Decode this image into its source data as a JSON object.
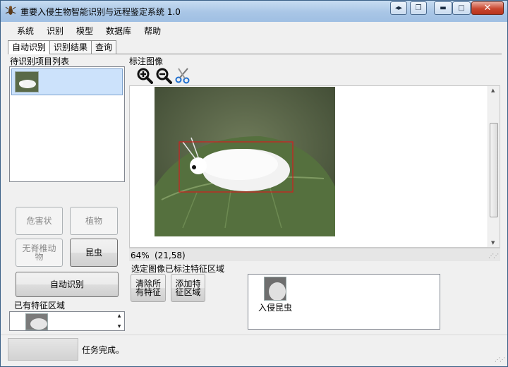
{
  "window": {
    "title": "重要入侵生物智能识别与远程鉴定系统 1.0",
    "accent": "#3a5f86"
  },
  "menu": [
    "系统",
    "识别",
    "模型",
    "数据库",
    "帮助"
  ],
  "tabs": [
    "自动识别",
    "识别结果",
    "查询"
  ],
  "left": {
    "pending_label": "待识别项目列表",
    "buttons": {
      "harm": "危害状",
      "plant": "植物",
      "invert_line1": "无脊椎动",
      "invert_line2": "物",
      "insect": "昆虫",
      "auto": "自动识别"
    },
    "feature_label": "已有特征区域"
  },
  "image_panel": {
    "label": "标注图像",
    "tools": [
      "zoom-in-icon",
      "zoom-out-icon",
      "scissors-icon"
    ],
    "zoom": "64%",
    "coords": "(21,58)",
    "selected_label": "选定图像已标注特征区域",
    "clear_line1": "清除所",
    "clear_line2": "有特征",
    "add_line1": "添加特",
    "add_line2": "征区域",
    "selected_item_label": "入侵昆虫"
  },
  "status": {
    "message": "任务完成。"
  },
  "colors": {
    "selection": "#cce2fb",
    "annotation_box": "#d21f1f"
  }
}
